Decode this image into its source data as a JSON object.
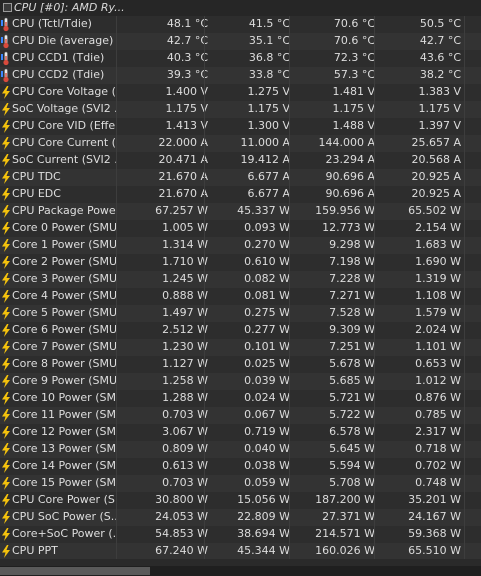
{
  "header": {
    "title": "CPU [#0]: AMD Ry..."
  },
  "icon_colors": {
    "thermometer": "#d84a3c",
    "bolt": "#f4c20d",
    "accent": "#3a86ff"
  },
  "rows": [
    {
      "icon": "thermometer-icon",
      "label": "CPU (Tctl/Tdie)",
      "values": [
        "48.1 °C",
        "41.5 °C",
        "70.6 °C",
        "50.5 °C"
      ]
    },
    {
      "icon": "thermometer-icon",
      "label": "CPU Die (average)",
      "values": [
        "42.7 °C",
        "35.1 °C",
        "70.6 °C",
        "42.7 °C"
      ]
    },
    {
      "icon": "thermometer-icon",
      "label": "CPU CCD1 (Tdie)",
      "values": [
        "40.3 °C",
        "36.8 °C",
        "72.3 °C",
        "43.6 °C"
      ]
    },
    {
      "icon": "thermometer-icon",
      "label": "CPU CCD2 (Tdie)",
      "values": [
        "39.3 °C",
        "33.8 °C",
        "57.3 °C",
        "38.2 °C"
      ]
    },
    {
      "icon": "bolt-icon",
      "label": "CPU Core Voltage (...",
      "values": [
        "1.400 V",
        "1.275 V",
        "1.481 V",
        "1.383 V"
      ]
    },
    {
      "icon": "bolt-icon",
      "label": "SoC Voltage (SVI2 ...",
      "values": [
        "1.175 V",
        "1.175 V",
        "1.175 V",
        "1.175 V"
      ]
    },
    {
      "icon": "bolt-icon",
      "label": "CPU Core VID (Effe...",
      "values": [
        "1.413 V",
        "1.300 V",
        "1.488 V",
        "1.397 V"
      ]
    },
    {
      "icon": "bolt-icon",
      "label": "CPU Core Current (...",
      "values": [
        "22.000 A",
        "11.000 A",
        "144.000 A",
        "25.657 A"
      ]
    },
    {
      "icon": "bolt-icon",
      "label": "SoC Current (SVI2 ...",
      "values": [
        "20.471 A",
        "19.412 A",
        "23.294 A",
        "20.568 A"
      ]
    },
    {
      "icon": "bolt-icon",
      "label": "CPU TDC",
      "values": [
        "21.670 A",
        "6.677 A",
        "90.696 A",
        "20.925 A"
      ]
    },
    {
      "icon": "bolt-icon",
      "label": "CPU EDC",
      "values": [
        "21.670 A",
        "6.677 A",
        "90.696 A",
        "20.925 A"
      ]
    },
    {
      "icon": "bolt-icon",
      "label": "CPU Package Powe...",
      "values": [
        "67.257 W",
        "45.337 W",
        "159.956 W",
        "65.502 W"
      ]
    },
    {
      "icon": "bolt-icon",
      "label": "Core 0 Power (SMU)",
      "values": [
        "1.005 W",
        "0.093 W",
        "12.773 W",
        "2.154 W"
      ]
    },
    {
      "icon": "bolt-icon",
      "label": "Core 1 Power (SMU)",
      "values": [
        "1.314 W",
        "0.270 W",
        "9.298 W",
        "1.683 W"
      ]
    },
    {
      "icon": "bolt-icon",
      "label": "Core 2 Power (SMU)",
      "values": [
        "1.710 W",
        "0.610 W",
        "7.198 W",
        "1.690 W"
      ]
    },
    {
      "icon": "bolt-icon",
      "label": "Core 3 Power (SMU)",
      "values": [
        "1.245 W",
        "0.082 W",
        "7.228 W",
        "1.319 W"
      ]
    },
    {
      "icon": "bolt-icon",
      "label": "Core 4 Power (SMU)",
      "values": [
        "0.888 W",
        "0.081 W",
        "7.271 W",
        "1.108 W"
      ]
    },
    {
      "icon": "bolt-icon",
      "label": "Core 5 Power (SMU)",
      "values": [
        "1.497 W",
        "0.275 W",
        "7.528 W",
        "1.579 W"
      ]
    },
    {
      "icon": "bolt-icon",
      "label": "Core 6 Power (SMU)",
      "values": [
        "2.512 W",
        "0.277 W",
        "9.309 W",
        "2.024 W"
      ]
    },
    {
      "icon": "bolt-icon",
      "label": "Core 7 Power (SMU)",
      "values": [
        "1.230 W",
        "0.101 W",
        "7.251 W",
        "1.101 W"
      ]
    },
    {
      "icon": "bolt-icon",
      "label": "Core 8 Power (SMU)",
      "values": [
        "1.127 W",
        "0.025 W",
        "5.678 W",
        "0.653 W"
      ]
    },
    {
      "icon": "bolt-icon",
      "label": "Core 9 Power (SMU)",
      "values": [
        "1.258 W",
        "0.039 W",
        "5.685 W",
        "1.012 W"
      ]
    },
    {
      "icon": "bolt-icon",
      "label": "Core 10 Power (SMU)",
      "values": [
        "1.288 W",
        "0.024 W",
        "5.721 W",
        "0.876 W"
      ]
    },
    {
      "icon": "bolt-icon",
      "label": "Core 11 Power (SMU)",
      "values": [
        "0.703 W",
        "0.067 W",
        "5.722 W",
        "0.785 W"
      ]
    },
    {
      "icon": "bolt-icon",
      "label": "Core 12 Power (SMU)",
      "values": [
        "3.067 W",
        "0.719 W",
        "6.578 W",
        "2.317 W"
      ]
    },
    {
      "icon": "bolt-icon",
      "label": "Core 13 Power (SMU)",
      "values": [
        "0.809 W",
        "0.040 W",
        "5.645 W",
        "0.718 W"
      ]
    },
    {
      "icon": "bolt-icon",
      "label": "Core 14 Power (SMU)",
      "values": [
        "0.613 W",
        "0.038 W",
        "5.594 W",
        "0.702 W"
      ]
    },
    {
      "icon": "bolt-icon",
      "label": "Core 15 Power (SMU)",
      "values": [
        "0.703 W",
        "0.059 W",
        "5.708 W",
        "0.748 W"
      ]
    },
    {
      "icon": "bolt-icon",
      "label": "CPU Core Power (S...",
      "values": [
        "30.800 W",
        "15.056 W",
        "187.200 W",
        "35.201 W"
      ]
    },
    {
      "icon": "bolt-icon",
      "label": "CPU SoC Power (S...",
      "values": [
        "24.053 W",
        "22.809 W",
        "27.371 W",
        "24.167 W"
      ]
    },
    {
      "icon": "bolt-icon",
      "label": "Core+SoC Power (...",
      "values": [
        "54.853 W",
        "38.694 W",
        "214.571 W",
        "59.368 W"
      ]
    },
    {
      "icon": "bolt-icon",
      "label": "CPU PPT",
      "values": [
        "67.240 W",
        "45.344 W",
        "160.026 W",
        "65.510 W"
      ]
    }
  ]
}
